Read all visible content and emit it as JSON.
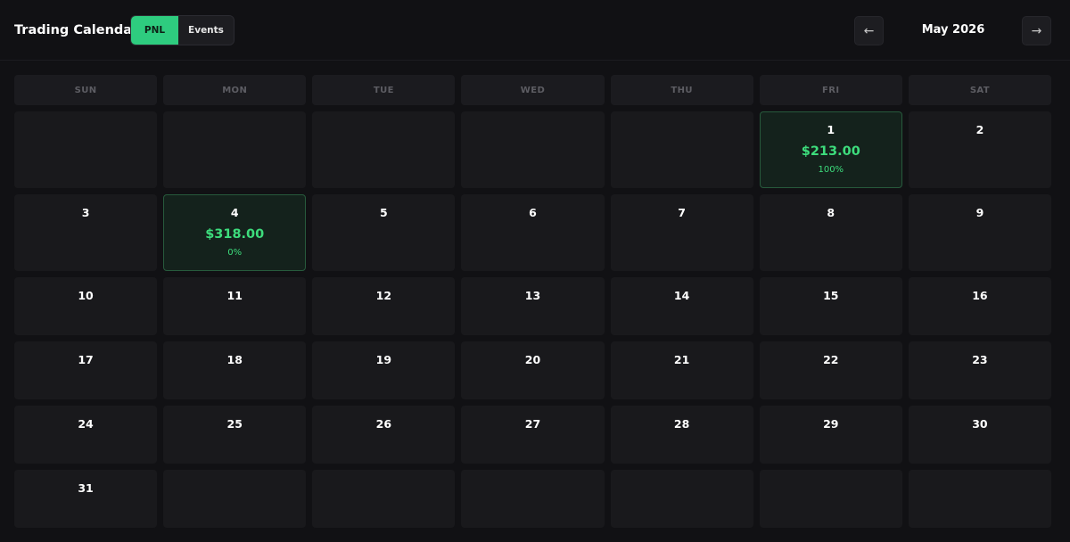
{
  "header": {
    "title": "Trading Calendar",
    "toggle": {
      "pnl_label": "PNL",
      "events_label": "Events",
      "active": "PNL"
    },
    "prev_icon": "←",
    "next_icon": "→",
    "month": "May 2026"
  },
  "weekdays": [
    "SUN",
    "MON",
    "TUE",
    "WED",
    "THU",
    "FRI",
    "SAT"
  ],
  "days": [
    null,
    null,
    null,
    null,
    null,
    {
      "day": "1",
      "pnl": "$213.00",
      "pct": "100%"
    },
    {
      "day": "2"
    },
    {
      "day": "3"
    },
    {
      "day": "4",
      "pnl": "$318.00",
      "pct": "0%"
    },
    {
      "day": "5"
    },
    {
      "day": "6"
    },
    {
      "day": "7"
    },
    {
      "day": "8"
    },
    {
      "day": "9"
    },
    {
      "day": "10"
    },
    {
      "day": "11"
    },
    {
      "day": "12"
    },
    {
      "day": "13"
    },
    {
      "day": "14"
    },
    {
      "day": "15"
    },
    {
      "day": "16"
    },
    {
      "day": "17"
    },
    {
      "day": "18"
    },
    {
      "day": "19"
    },
    {
      "day": "20"
    },
    {
      "day": "21"
    },
    {
      "day": "22"
    },
    {
      "day": "23"
    },
    {
      "day": "24"
    },
    {
      "day": "25"
    },
    {
      "day": "26"
    },
    {
      "day": "27"
    },
    {
      "day": "28"
    },
    {
      "day": "29"
    },
    {
      "day": "30"
    },
    {
      "day": "31"
    },
    null,
    null,
    null,
    null,
    null,
    null
  ],
  "colors": {
    "background": "#111114",
    "accent_green": "#2ecc7f",
    "profit_text": "#3ddc7c",
    "profit_cell_bg": "#14221c",
    "profit_cell_border": "#275a3c",
    "cell_bg": "#19191c"
  }
}
